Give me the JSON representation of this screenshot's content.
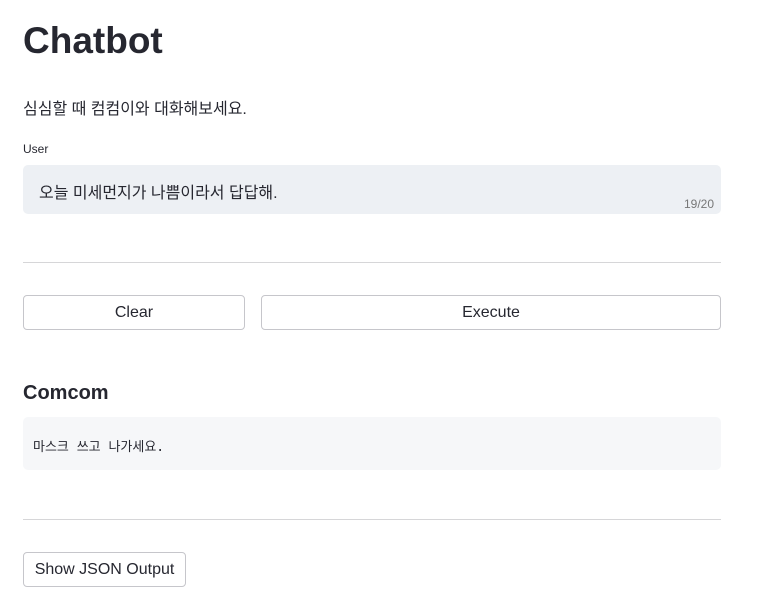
{
  "page": {
    "title": "Chatbot",
    "subtitle": "심심할 때 컴컴이와 대화해보세요."
  },
  "input": {
    "label": "User",
    "value": "오늘 미세먼지가 나쁨이라서 답답해.",
    "char_count": "19/20"
  },
  "buttons": {
    "clear": "Clear",
    "execute": "Execute",
    "show_json": "Show JSON Output"
  },
  "output": {
    "heading": "Comcom",
    "text": "마스크 쓰고 나가세요."
  }
}
